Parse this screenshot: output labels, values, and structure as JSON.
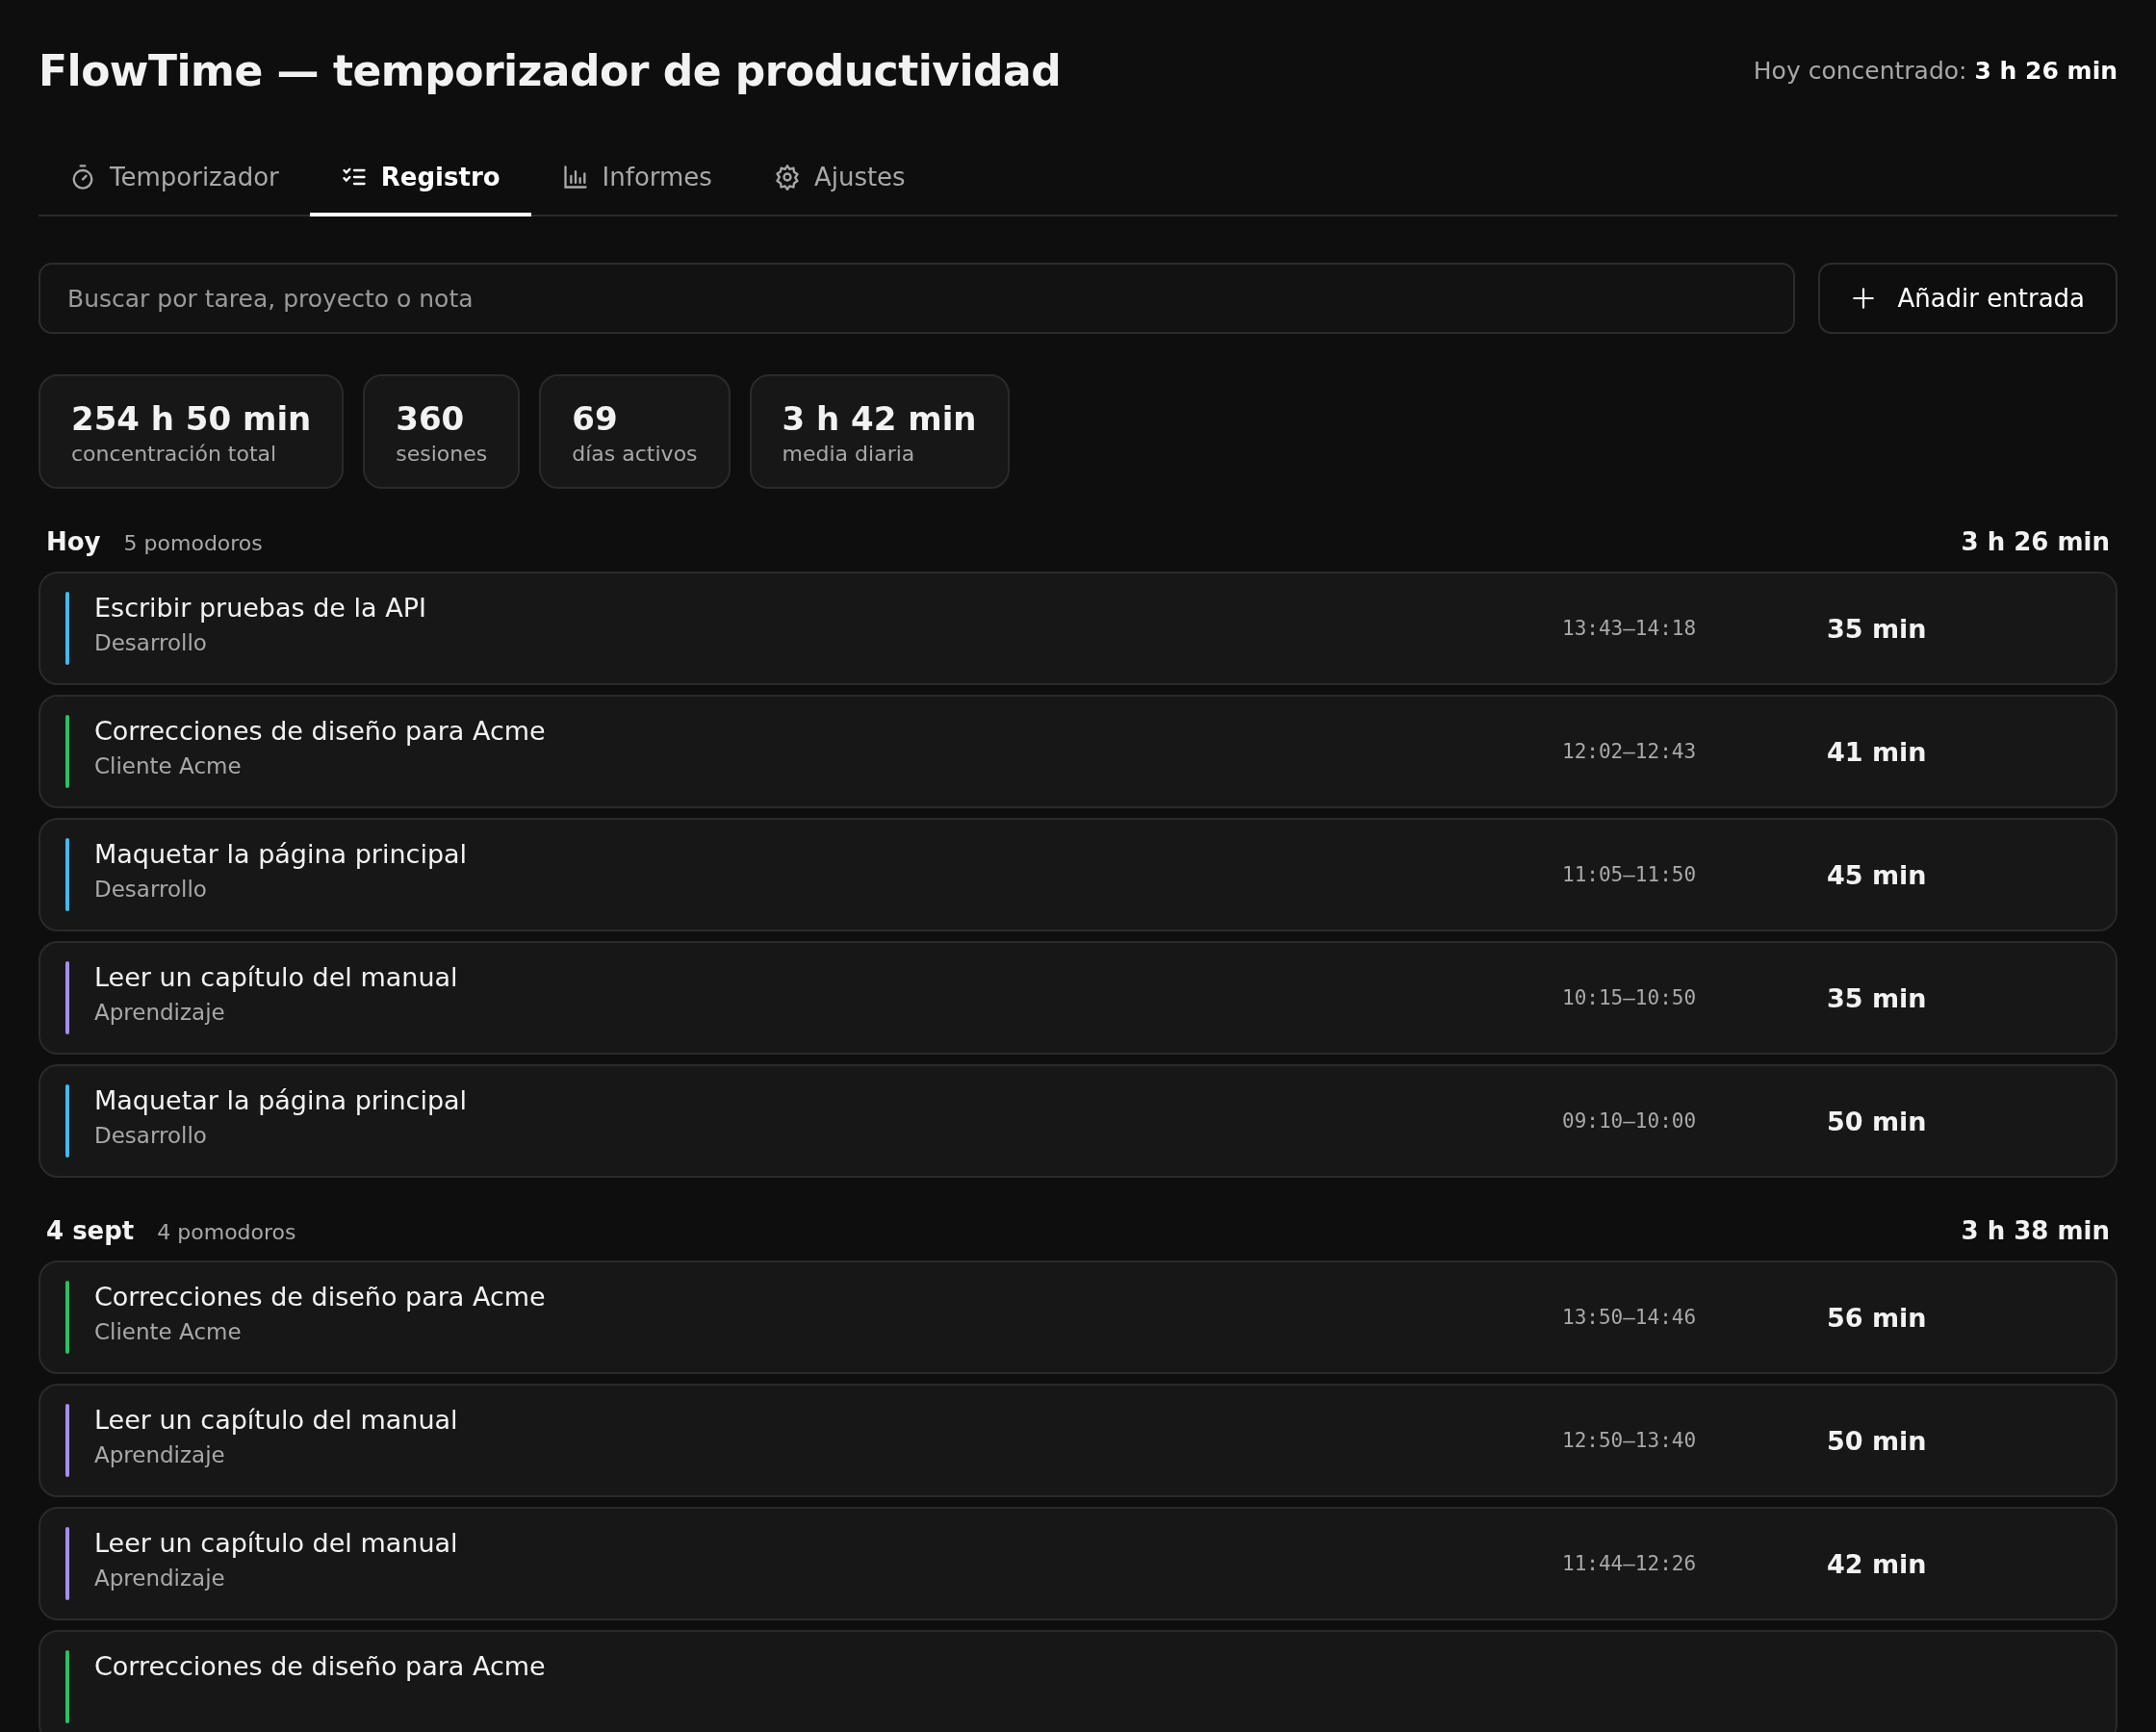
{
  "header": {
    "title": "FlowTime — temporizador de productividad",
    "today_label": "Hoy concentrado:",
    "today_value": "3 h 26 min"
  },
  "tabs": [
    {
      "label": "Temporizador",
      "kind": "timer",
      "selected": false
    },
    {
      "label": "Registro",
      "kind": "list",
      "selected": true
    },
    {
      "label": "Informes",
      "kind": "chart",
      "selected": false
    },
    {
      "label": "Ajustes",
      "kind": "gear",
      "selected": false
    }
  ],
  "search": {
    "placeholder": "Buscar por tarea, proyecto o nota"
  },
  "add_button": {
    "label": "Añadir entrada"
  },
  "stats": [
    {
      "value": "254 h 50 min",
      "label": "concentración total"
    },
    {
      "value": "360",
      "label": "sesiones"
    },
    {
      "value": "69",
      "label": "días activos"
    },
    {
      "value": "3 h 42 min",
      "label": "media diaria"
    }
  ],
  "groups": [
    {
      "day": "Hoy",
      "count": "5 pomodoros",
      "total": "3 h 26 min",
      "entries": [
        {
          "title": "Escribir pruebas de la API",
          "project": "Desarrollo",
          "color": "#38bdf8",
          "time": "13:43–14:18",
          "duration": "35 min"
        },
        {
          "title": "Correcciones de diseño para Acme",
          "project": "Cliente Acme",
          "color": "#22c55e",
          "time": "12:02–12:43",
          "duration": "41 min"
        },
        {
          "title": "Maquetar la página principal",
          "project": "Desarrollo",
          "color": "#38bdf8",
          "time": "11:05–11:50",
          "duration": "45 min"
        },
        {
          "title": "Leer un capítulo del manual",
          "project": "Aprendizaje",
          "color": "#a78bfa",
          "time": "10:15–10:50",
          "duration": "35 min"
        },
        {
          "title": "Maquetar la página principal",
          "project": "Desarrollo",
          "color": "#38bdf8",
          "time": "09:10–10:00",
          "duration": "50 min"
        }
      ]
    },
    {
      "day": "4 sept",
      "count": "4 pomodoros",
      "total": "3 h 38 min",
      "entries": [
        {
          "title": "Correcciones de diseño para Acme",
          "project": "Cliente Acme",
          "color": "#22c55e",
          "time": "13:50–14:46",
          "duration": "56 min"
        },
        {
          "title": "Leer un capítulo del manual",
          "project": "Aprendizaje",
          "color": "#a78bfa",
          "time": "12:50–13:40",
          "duration": "50 min"
        },
        {
          "title": "Leer un capítulo del manual",
          "project": "Aprendizaje",
          "color": "#a78bfa",
          "time": "11:44–12:26",
          "duration": "42 min"
        },
        {
          "title": "Correcciones de diseño para Acme",
          "color": "#22c55e"
        }
      ]
    }
  ]
}
